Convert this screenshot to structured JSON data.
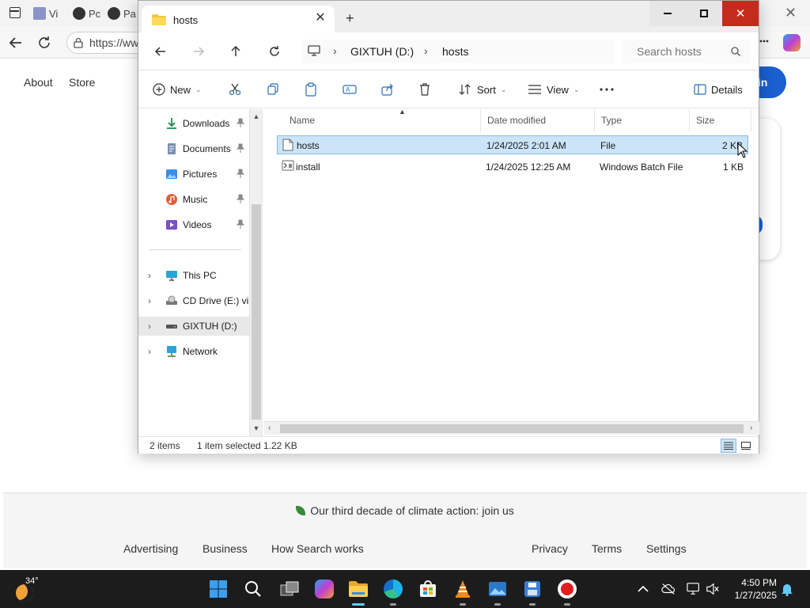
{
  "browser": {
    "url_text": "https://ww",
    "tab_labels": [
      "Vi",
      "Pc",
      "Pa"
    ],
    "nav_links": [
      "About",
      "Store"
    ],
    "signin_label": "in",
    "footer": {
      "climate_text": "Our third decade of climate action: join us",
      "links_left": [
        "Advertising",
        "Business",
        "How Search works"
      ],
      "links_right": [
        "Privacy",
        "Terms",
        "Settings"
      ]
    }
  },
  "explorer": {
    "tab_title": "hosts",
    "address": {
      "segments": [
        "GIXTUH (D:)",
        "hosts"
      ]
    },
    "search": {
      "placeholder": "Search hosts"
    },
    "commands": {
      "new": "New",
      "sort": "Sort",
      "view": "View",
      "details": "Details"
    },
    "nav_items": [
      {
        "label": "Downloads",
        "icon": "download-icon",
        "pinned": true
      },
      {
        "label": "Documents",
        "icon": "documents-icon",
        "pinned": true
      },
      {
        "label": "Pictures",
        "icon": "pictures-icon",
        "pinned": true
      },
      {
        "label": "Music",
        "icon": "music-icon",
        "pinned": true
      },
      {
        "label": "Videos",
        "icon": "videos-icon",
        "pinned": true
      },
      {
        "label": "This PC",
        "icon": "computer-icon"
      },
      {
        "label": "CD Drive (E:) virt",
        "icon": "cd-drive-icon"
      },
      {
        "label": "GIXTUH (D:)",
        "icon": "drive-icon",
        "selected": true
      },
      {
        "label": "Network",
        "icon": "network-icon"
      }
    ],
    "columns": [
      "Name",
      "Date modified",
      "Type",
      "Size"
    ],
    "files": [
      {
        "name": "hosts",
        "date": "1/24/2025 2:01 AM",
        "type": "File",
        "size": "2 KB",
        "selected": true
      },
      {
        "name": "install",
        "date": "1/24/2025 12:25 AM",
        "type": "Windows Batch File",
        "size": "1 KB",
        "selected": false
      }
    ],
    "status": {
      "items": "2 items",
      "selected": "1 item selected",
      "size": "1.22 KB"
    }
  },
  "taskbar": {
    "weather_temp": "34°",
    "time": "4:50 PM",
    "date": "1/27/2025"
  },
  "colors": {
    "accent": "#0078d4",
    "selection": "#cce4f7",
    "close": "#c42b1c",
    "taskbar": "#1c1c1c"
  }
}
